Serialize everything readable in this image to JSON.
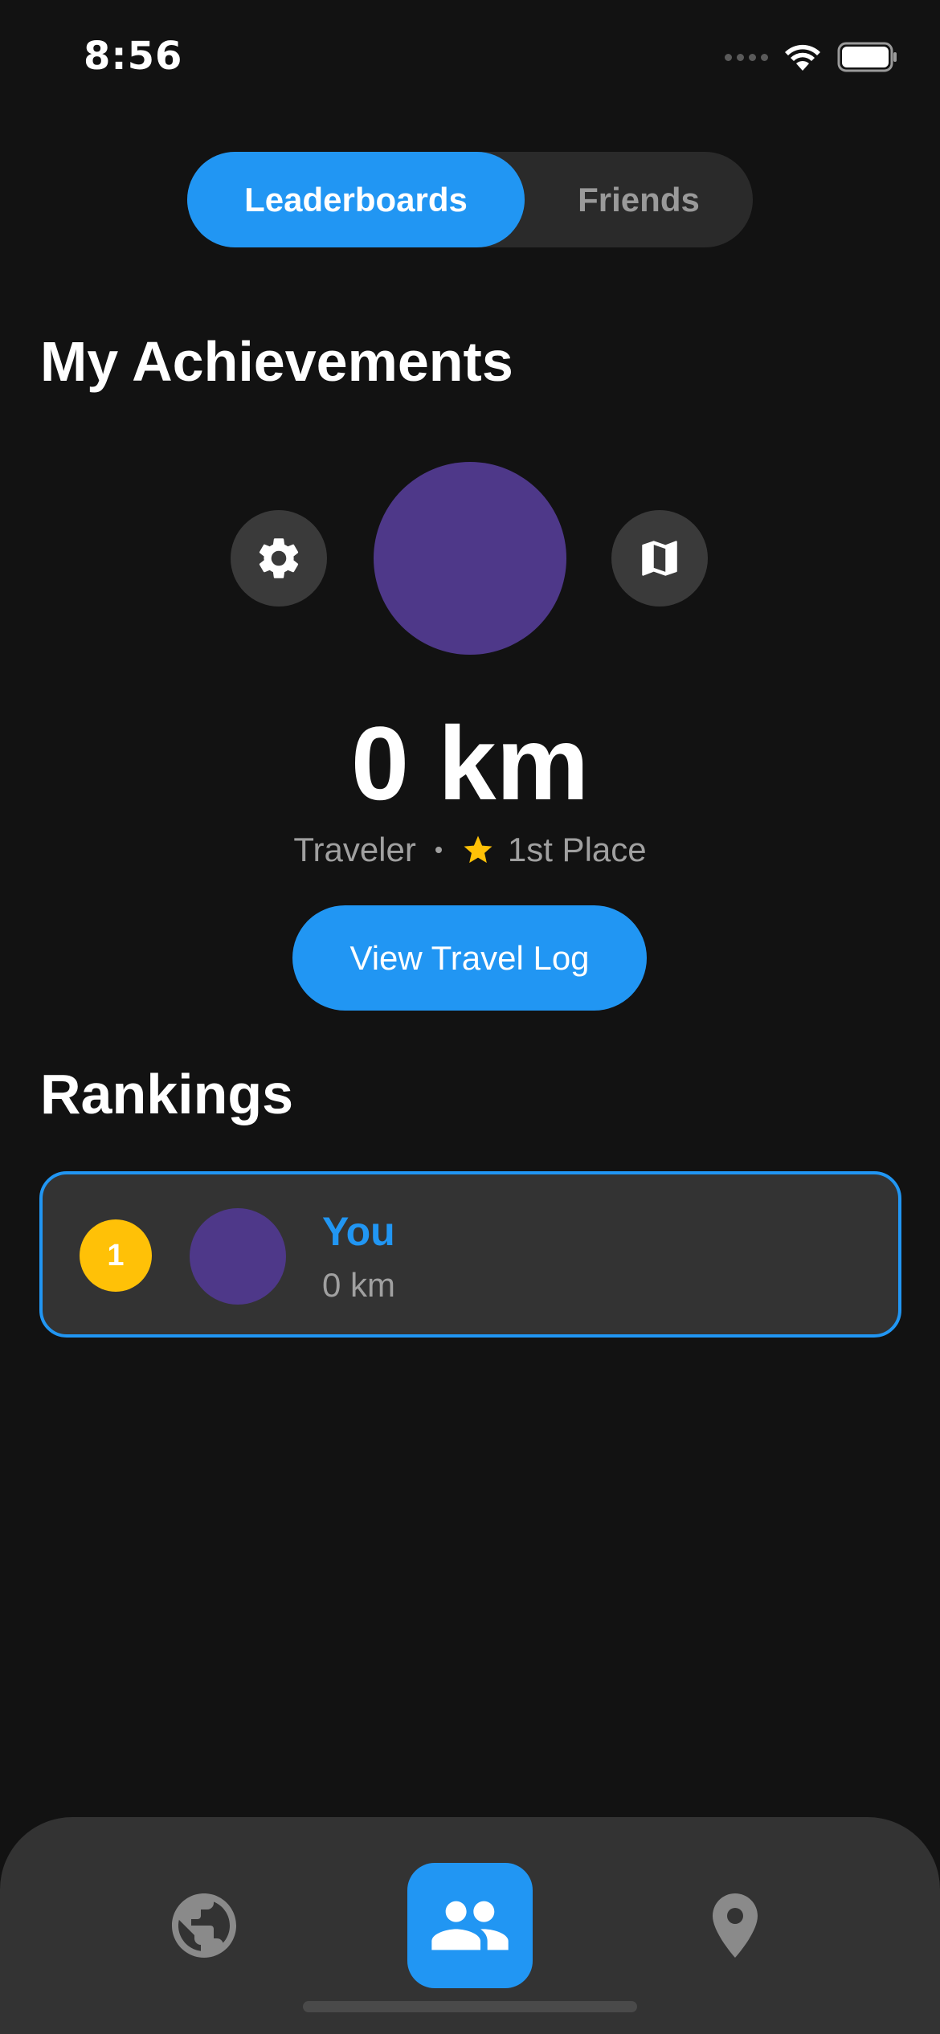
{
  "status_bar": {
    "time": "8:56"
  },
  "segmented": {
    "active_label": "Leaderboards",
    "inactive_label": "Friends"
  },
  "achievements": {
    "title": "My Achievements",
    "distance": "0 km",
    "rank_title": "Traveler",
    "place": "1st Place",
    "travel_log_button": "View Travel Log",
    "left_icon": "gear-icon",
    "right_icon": "map-icon"
  },
  "rankings": {
    "title": "Rankings",
    "entries": [
      {
        "rank": "1",
        "name": "You",
        "distance": "0 km"
      }
    ]
  },
  "bottom_nav": {
    "items": [
      "globe-icon",
      "people-icon",
      "location-pin-icon"
    ],
    "active_index": 1
  },
  "colors": {
    "background": "#121212",
    "accent": "#2196f3",
    "avatar": "#4e3889",
    "gold": "#ffc107",
    "card": "#333333"
  }
}
